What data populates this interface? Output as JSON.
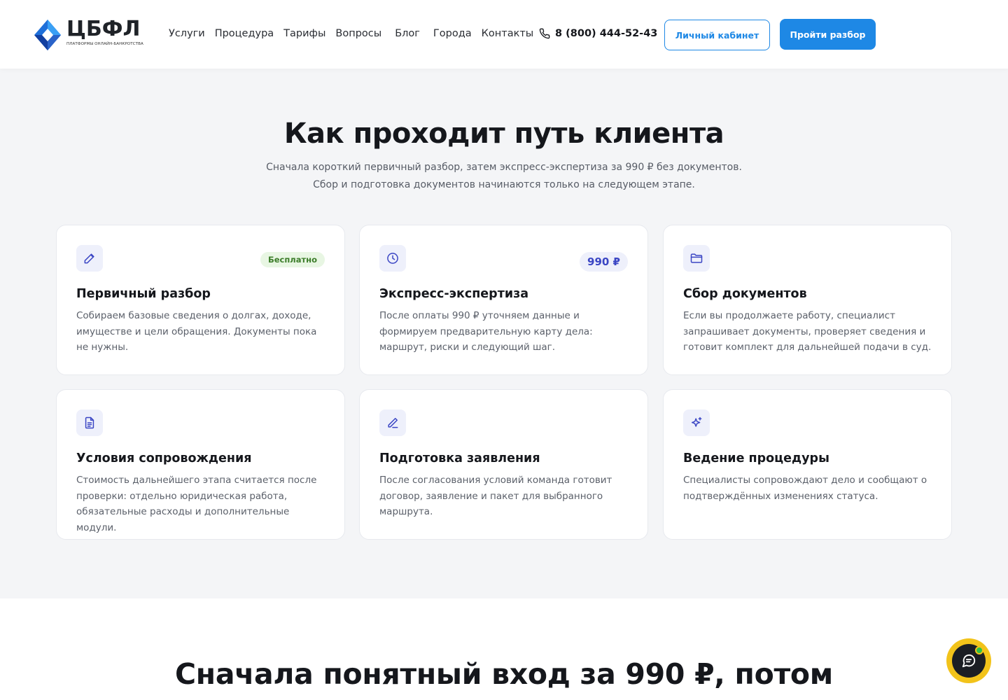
{
  "header": {
    "logo_title": "ЦБФЛ",
    "logo_subtitle": "ПЛАТФОРМЫ ОНЛАЙН-БАНКРОТСТВА",
    "nav": [
      "Услуги",
      "Процедура",
      "Тарифы",
      "Вопросы",
      "Блог",
      "Города",
      "Контакты"
    ],
    "phone": "8 (800) 444-52-43",
    "account_label": "Личный кабинет",
    "cta_label": "Пройти разбор",
    "accent": "#1e88e5"
  },
  "section": {
    "title": "Как проходит путь клиента",
    "lead": "Сначала короткий первичный разбор, затем экспресс-экспертиза за 990 ₽ без документов. Сбор и подготовка документов начинаются только на следующем этапе."
  },
  "cards": [
    {
      "icon": "pencil-icon",
      "title": "Первичный разбор",
      "badge": "Бесплатно",
      "desc": "Собираем базовые сведения о долгах, доходе, имуществе и цели обращения. Документы пока не нужны."
    },
    {
      "icon": "clock-icon",
      "title": "Экспресс-экспертиза",
      "badge": "990 ₽",
      "desc": "После оплаты 990 ₽ уточняем данные и формируем предварительную карту дела: маршрут, риски и следующий шаг."
    },
    {
      "icon": "folder-icon",
      "title": "Сбор документов",
      "badge": "",
      "desc": "Если вы продолжаете работу, специалист запрашивает документы, проверяет сведения и готовит комплект для дальнейшей подачи в суд."
    },
    {
      "icon": "document-icon",
      "title": "Условия сопровождения",
      "badge": "",
      "desc": "Стоимость дальнейшего этапа считается после проверки: отдельно юридическая работа, обязательные расходы и дополнительные модули."
    },
    {
      "icon": "pen-icon",
      "title": "Подготовка заявления",
      "badge": "",
      "desc": "После согласования условий команда готовит договор, заявление и пакет для выбранного маршрута."
    },
    {
      "icon": "sparkle-icon",
      "title": "Ведение процедуры",
      "badge": "",
      "desc": "Специалисты сопровождают дело и сообщают о подтверждённых изменениях статуса."
    }
  ],
  "bottom": {
    "title": "Сначала понятный вход за 990 ₽, потом"
  }
}
